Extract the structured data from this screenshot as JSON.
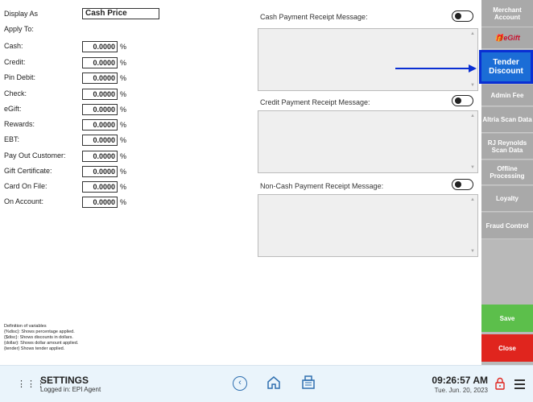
{
  "form": {
    "display_as_label": "Display As",
    "display_as_value": "Cash Price",
    "apply_to_label": "Apply To:",
    "pct_symbol": "%",
    "fields": [
      {
        "label": "Cash:",
        "value": "0.0000"
      },
      {
        "label": "Credit:",
        "value": "0.0000"
      },
      {
        "label": "Pin Debit:",
        "value": "0.0000"
      },
      {
        "label": "Check:",
        "value": "0.0000"
      },
      {
        "label": "eGift:",
        "value": "0.0000"
      },
      {
        "label": "Rewards:",
        "value": "0.0000"
      },
      {
        "label": "EBT:",
        "value": "0.0000"
      },
      {
        "label": "Pay Out Customer:",
        "value": "0.0000"
      },
      {
        "label": "Gift Certificate:",
        "value": "0.0000"
      },
      {
        "label": "Card On File:",
        "value": "0.0000"
      },
      {
        "label": "On Account:",
        "value": "0.0000"
      }
    ],
    "definitions": [
      "Definition of variables",
      "{%disc}: Shows percentage applied.",
      "{$disc}: Shows discounts in dollars.",
      "{dollar}: Shows dollar amount applied.",
      "{tender} Shows tender applied."
    ]
  },
  "messages": {
    "cash_label": "Cash Payment Receipt Message:",
    "credit_label": "Credit Payment Receipt Message:",
    "noncash_label": "Non-Cash Payment Receipt Message:",
    "cash_toggle": "off",
    "credit_toggle": "off",
    "noncash_toggle": "off"
  },
  "sidebar": {
    "items": [
      {
        "label": "Merchant Account"
      },
      {
        "label": "eGift"
      },
      {
        "label": "Tender Discount",
        "active": true
      },
      {
        "label": "Admin Fee"
      },
      {
        "label": "Altria Scan Data"
      },
      {
        "label": "RJ Reynolds Scan Data"
      },
      {
        "label": "Offline Processing"
      },
      {
        "label": "Loyalty"
      },
      {
        "label": "Fraud Control"
      }
    ],
    "save_label": "Save",
    "close_label": "Close"
  },
  "bottombar": {
    "title": "SETTINGS",
    "logged_in": "Logged in:  EPI Agent",
    "time": "09:26:57 AM",
    "date": "Tue. Jun. 20, 2023"
  },
  "colors": {
    "active_tab": "#1b6dd6",
    "save": "#5cbf4b",
    "close": "#e0251e",
    "sidebar": "#a9a9a9"
  }
}
